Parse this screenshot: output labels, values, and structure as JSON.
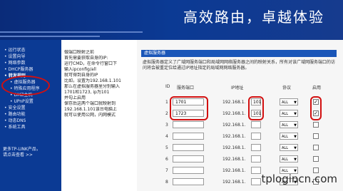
{
  "banner": {
    "title": "高效路由，卓越体验"
  },
  "sidebar": {
    "items": [
      {
        "label": "• 运行状态",
        "sub": false
      },
      {
        "label": "• 设置向导",
        "sub": false
      },
      {
        "label": "• 网络参数",
        "sub": false
      },
      {
        "label": "• DHCP服务器",
        "sub": false
      },
      {
        "label": "• 转发规则",
        "sub": false,
        "active": true
      },
      {
        "label": "• 虚拟服务器",
        "sub": true
      },
      {
        "label": "• 特殊应用程序",
        "sub": true
      },
      {
        "label": "• DMZ主机",
        "sub": true
      },
      {
        "label": "• UPnP设置",
        "sub": true
      },
      {
        "label": "• 安全设置",
        "sub": false
      },
      {
        "label": "• 路由功能",
        "sub": false
      },
      {
        "label": "• 动态DNS",
        "sub": false
      },
      {
        "label": "• 系统工具",
        "sub": false
      }
    ],
    "more_line1": "更多TP-LINK产品，",
    "more_line2": "请点击查看 >>"
  },
  "notes": {
    "lines": [
      "做端口映射之前",
      "首先需要获取自身的IP:",
      "运行CMD，在命令行窗口下",
      "输入ipconfig/all",
      "就可得到自身的IP",
      "比如，设置为192.168.1.101",
      "那么在虚拟服务器里分别输入",
      "1701和1723, ip为101",
      "并勾上启用",
      "保存后这两个端口就映射到",
      "192.168.1.101该台电脑上",
      "就可以使用公网，内网模式"
    ]
  },
  "panel": {
    "header": "虚拟服务器",
    "desc": "虚拟服务器定义了广域网服务端口和局域网网络服务器之间的映射关系，所有对该广域网服务端口的访问将会被重定位给通过IP地址指定的局域网网络服务器。",
    "col_id": "ID",
    "col_port": "服务端口",
    "col_ip": "IP地址",
    "col_proto": "协议",
    "col_enable": "启用",
    "rows": [
      {
        "id": "1",
        "port": "1701",
        "ip_prefix": "192.168.1.",
        "ip_last": "101",
        "proto": "ALL",
        "enabled": "✓"
      },
      {
        "id": "2",
        "port": "1723",
        "ip_prefix": "192.168.1.",
        "ip_last": "101",
        "proto": "ALL",
        "enabled": "✓"
      },
      {
        "id": "3",
        "port": "",
        "ip_prefix": "192.168.1.",
        "ip_last": "",
        "proto": "ALL",
        "enabled": ""
      },
      {
        "id": "4",
        "port": "",
        "ip_prefix": "192.168.1.",
        "ip_last": "",
        "proto": "ALL",
        "enabled": ""
      },
      {
        "id": "5",
        "port": "",
        "ip_prefix": "192.168.1.",
        "ip_last": "",
        "proto": "ALL",
        "enabled": ""
      },
      {
        "id": "6",
        "port": "",
        "ip_prefix": "192.168.1.",
        "ip_last": "",
        "proto": "ALL",
        "enabled": ""
      },
      {
        "id": "7",
        "port": "",
        "ip_prefix": "192.168.1.",
        "ip_last": "",
        "proto": "ALL",
        "enabled": ""
      },
      {
        "id": "8",
        "port": "",
        "ip_prefix": "192.168.1.",
        "ip_last": "",
        "proto": "ALL",
        "enabled": ""
      }
    ]
  },
  "watermark": "tplogincn.com"
}
